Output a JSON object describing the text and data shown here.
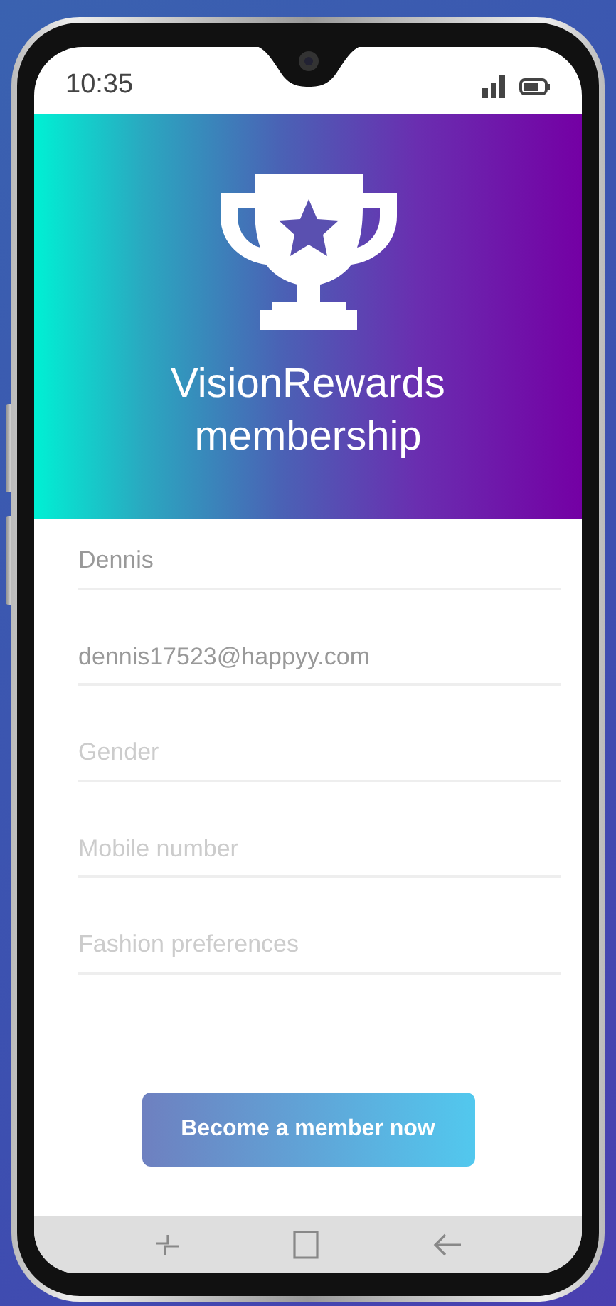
{
  "status_bar": {
    "time": "10:35"
  },
  "header": {
    "title": "VisionRewards membership"
  },
  "fields": [
    {
      "value": "Dennis"
    },
    {
      "value": "dennis17523@happyy.com"
    },
    {
      "placeholder": "Gender"
    },
    {
      "placeholder": "Mobile number"
    },
    {
      "placeholder": "Fashion preferences"
    }
  ],
  "submit_button": "Become a member now"
}
